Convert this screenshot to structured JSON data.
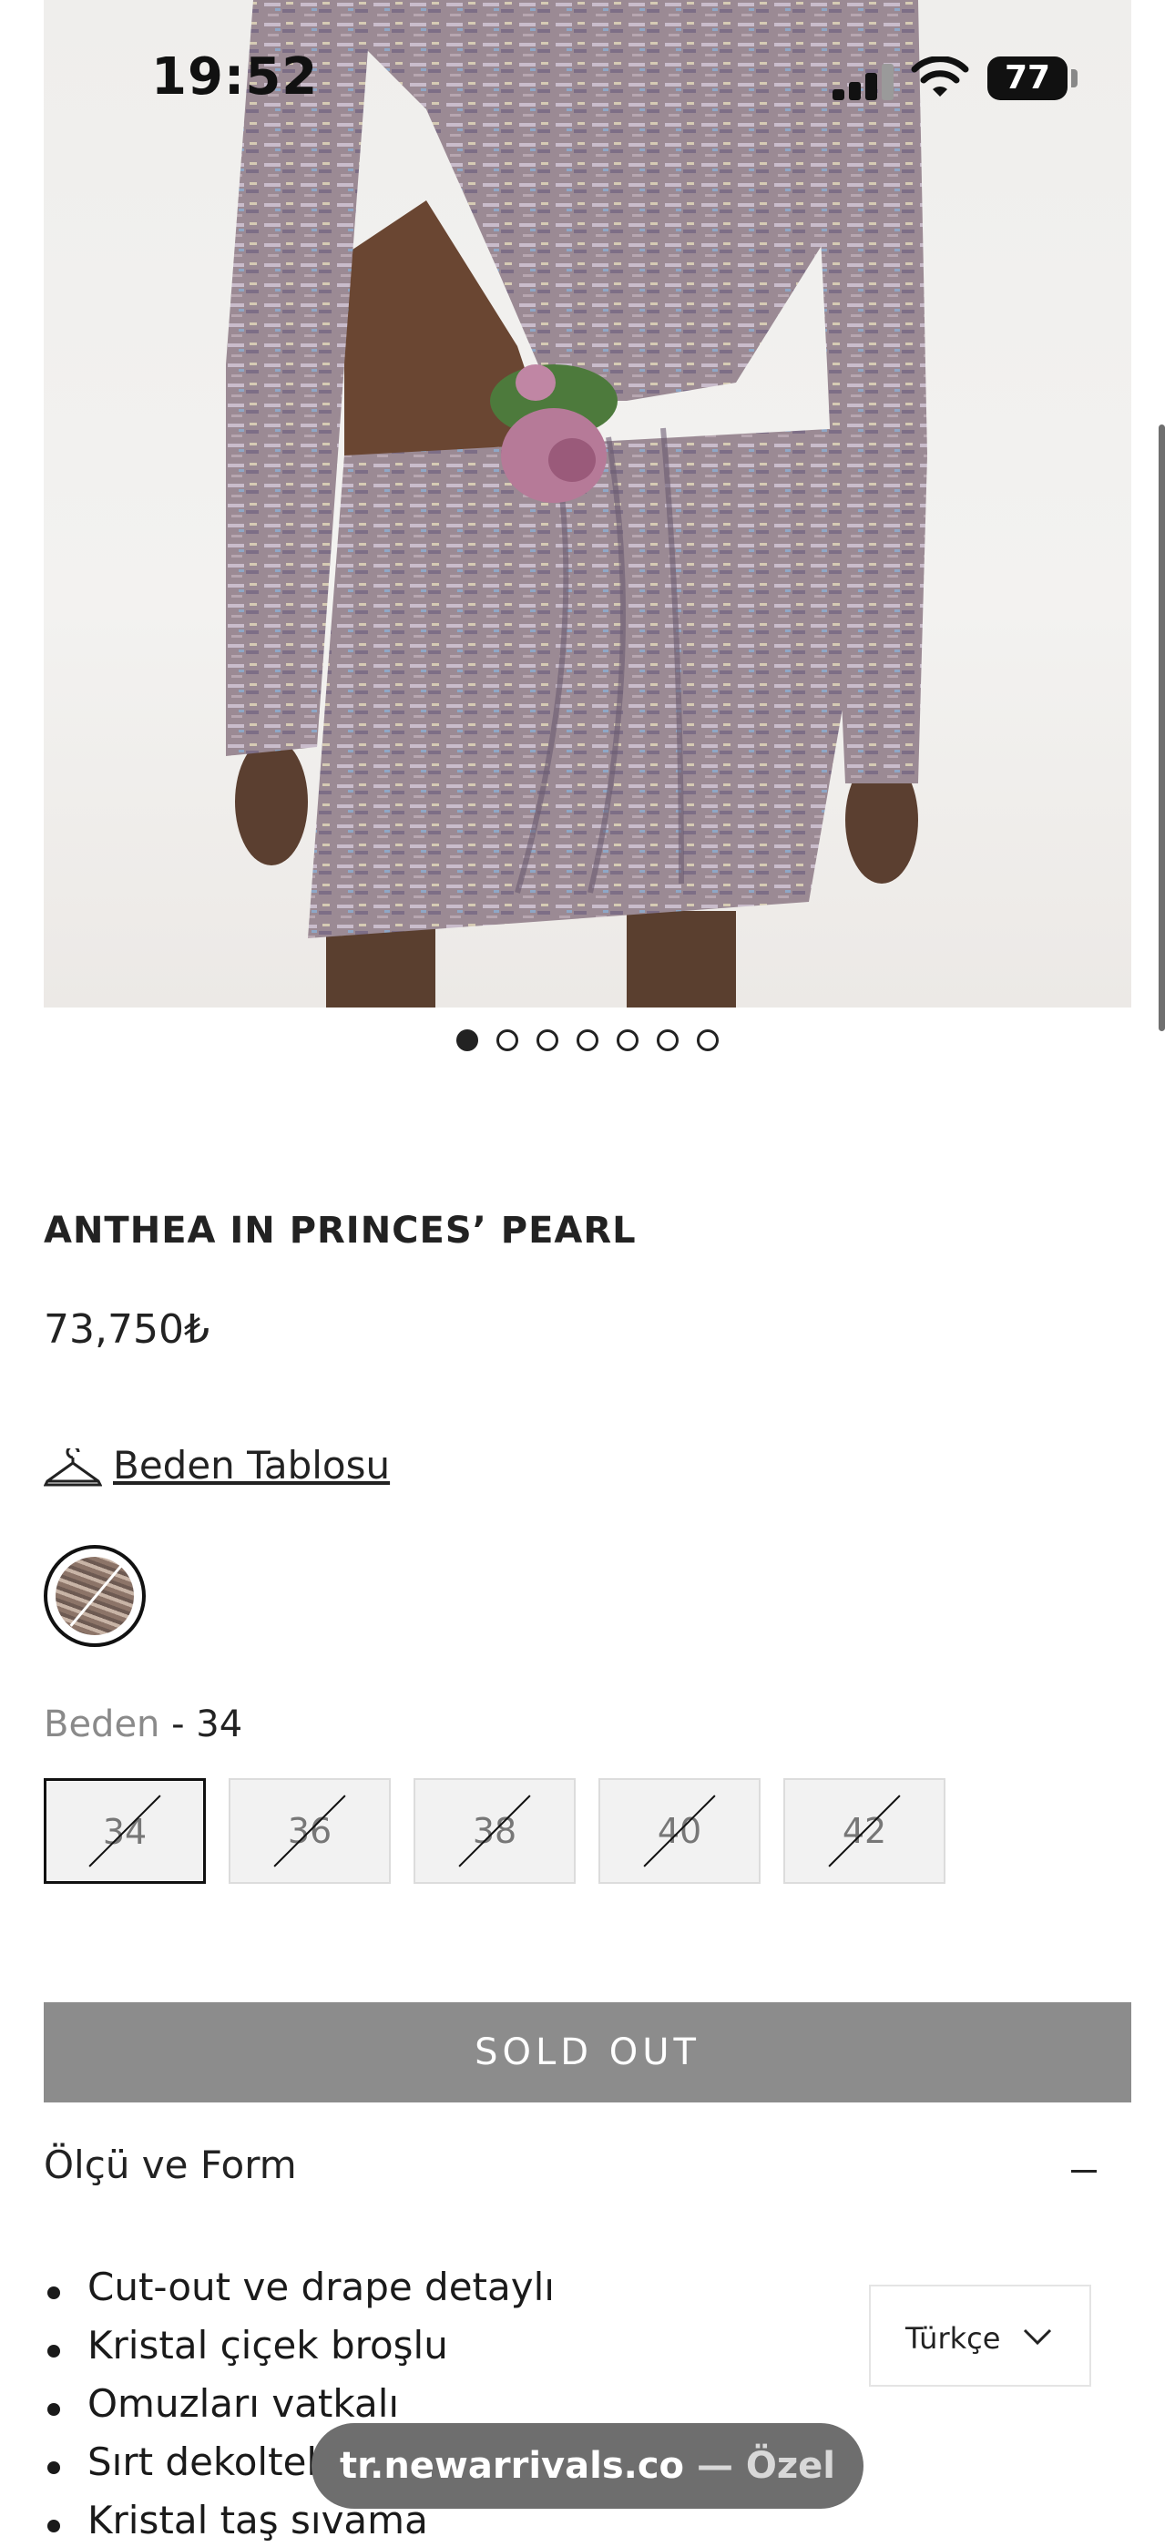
{
  "status_bar": {
    "time": "19:52",
    "battery": "77"
  },
  "carousel": {
    "total": 7,
    "active_index": 0
  },
  "product": {
    "title": "ANTHEA IN PRINCES’ PEARL",
    "price": "73,750₺",
    "size_guide": "Beden Tablosu",
    "size_label": "Beden",
    "selected_size": "- 34",
    "sizes": [
      "34",
      "36",
      "38",
      "40",
      "42"
    ],
    "sold_out": "SOLD OUT"
  },
  "accordion": {
    "title": "Ölçü ve Form",
    "items": [
      "Cut-out ve drape detaylı",
      "Kristal çiçek broşlu",
      "Omuzları vatkalı",
      "Sırt dekoltel",
      "Kristal taş sıvama"
    ]
  },
  "language": {
    "selected": "Türkçe"
  },
  "browser": {
    "domain": "tr.newarrivals.co",
    "private_label": " — Özel"
  },
  "colors": {
    "sold_out_bg": "#8c8c8c",
    "pill_bg": "#6e6e6e"
  },
  "icons": [
    "hanger-icon",
    "chevron-down-icon",
    "wifi-icon",
    "signal-icon",
    "battery-icon"
  ]
}
